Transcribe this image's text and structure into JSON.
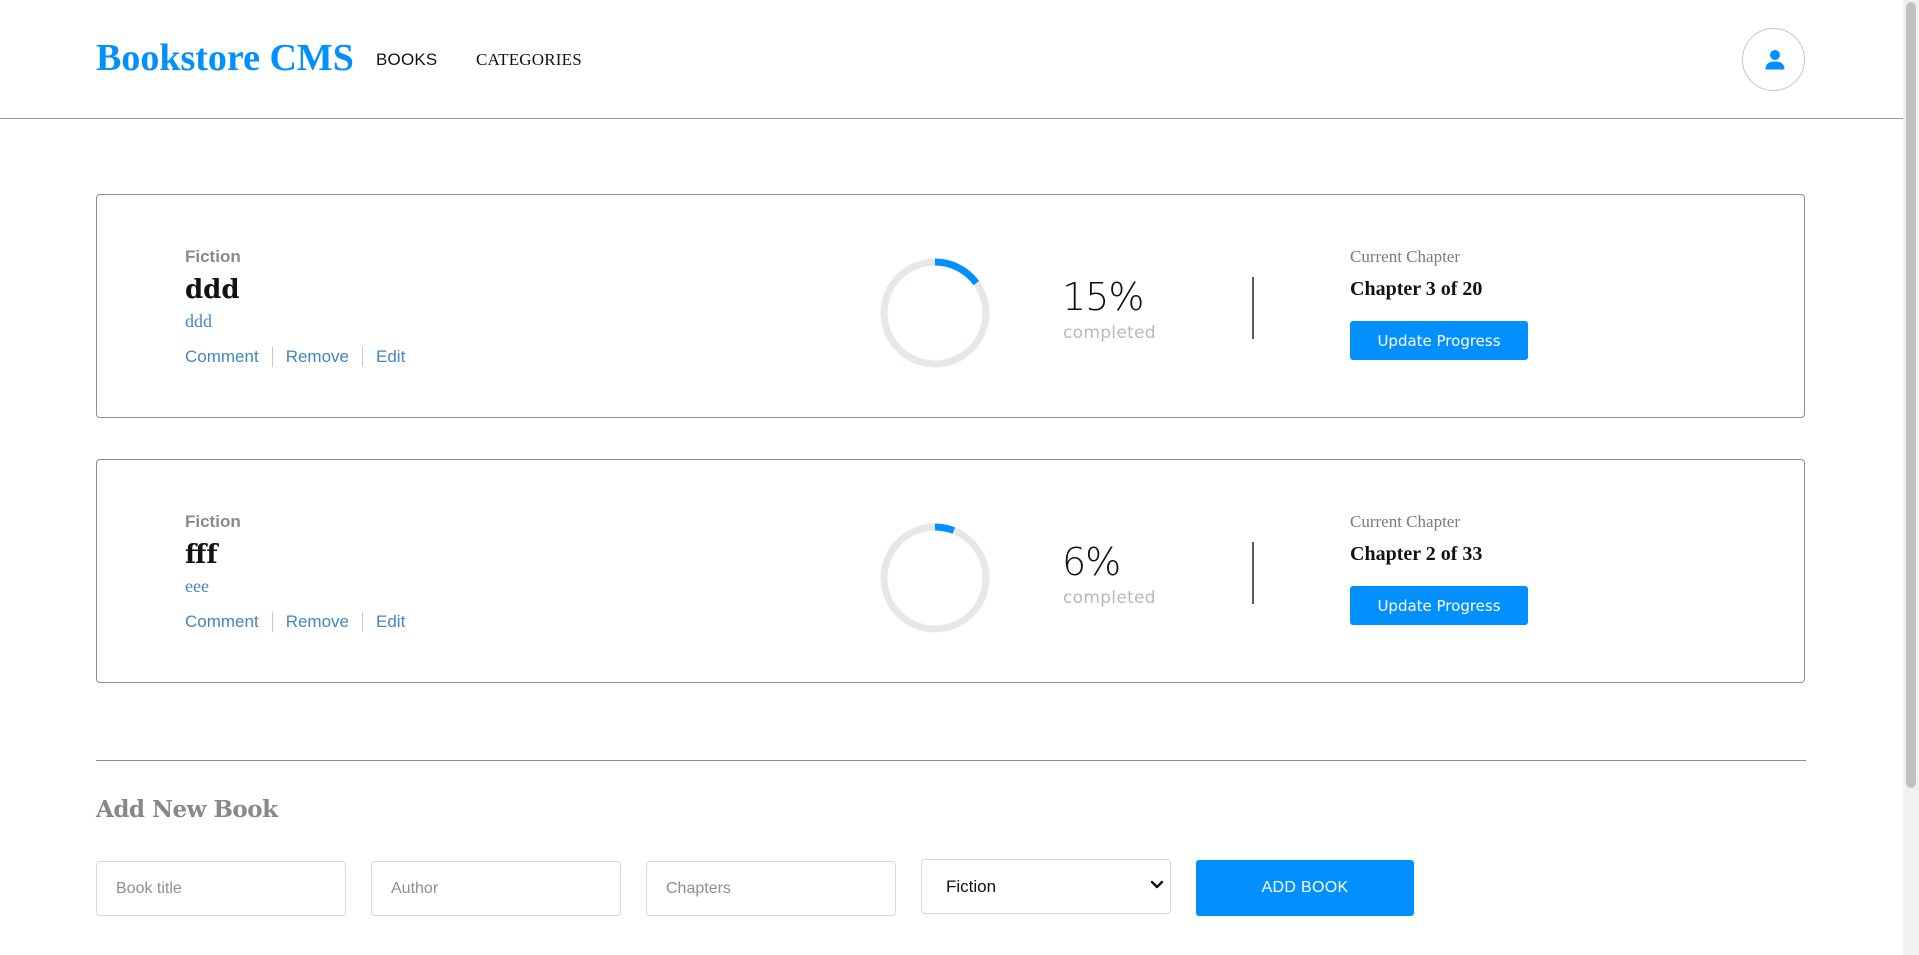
{
  "header": {
    "logo": "Bookstore CMS",
    "nav": [
      {
        "label": "BOOKS"
      },
      {
        "label": "CATEGORIES"
      }
    ],
    "user_icon": "user-icon"
  },
  "books": [
    {
      "genre": "Fiction",
      "title": "ddd",
      "author": "ddd",
      "actions": [
        "Comment",
        "Remove",
        "Edit"
      ],
      "progress_percent": 15,
      "percent_label": "15%",
      "completed_label": "completed",
      "chapter_heading": "Current Chapter",
      "chapter": "Chapter 3 of 20",
      "update_label": "Update Progress"
    },
    {
      "genre": "Fiction",
      "title": "fff",
      "author": "eee",
      "actions": [
        "Comment",
        "Remove",
        "Edit"
      ],
      "progress_percent": 6,
      "percent_label": "6%",
      "completed_label": "completed",
      "chapter_heading": "Current Chapter",
      "chapter": "Chapter 2 of 33",
      "update_label": "Update Progress"
    }
  ],
  "add_form": {
    "title": "Add New Book",
    "title_placeholder": "Book title",
    "author_placeholder": "Author",
    "chapters_placeholder": "Chapters",
    "category_selected": "Fiction",
    "submit_label": "ADD BOOK"
  },
  "colors": {
    "accent": "#0290ff",
    "link": "#4386bf",
    "ring_track": "#e8e6e6"
  }
}
